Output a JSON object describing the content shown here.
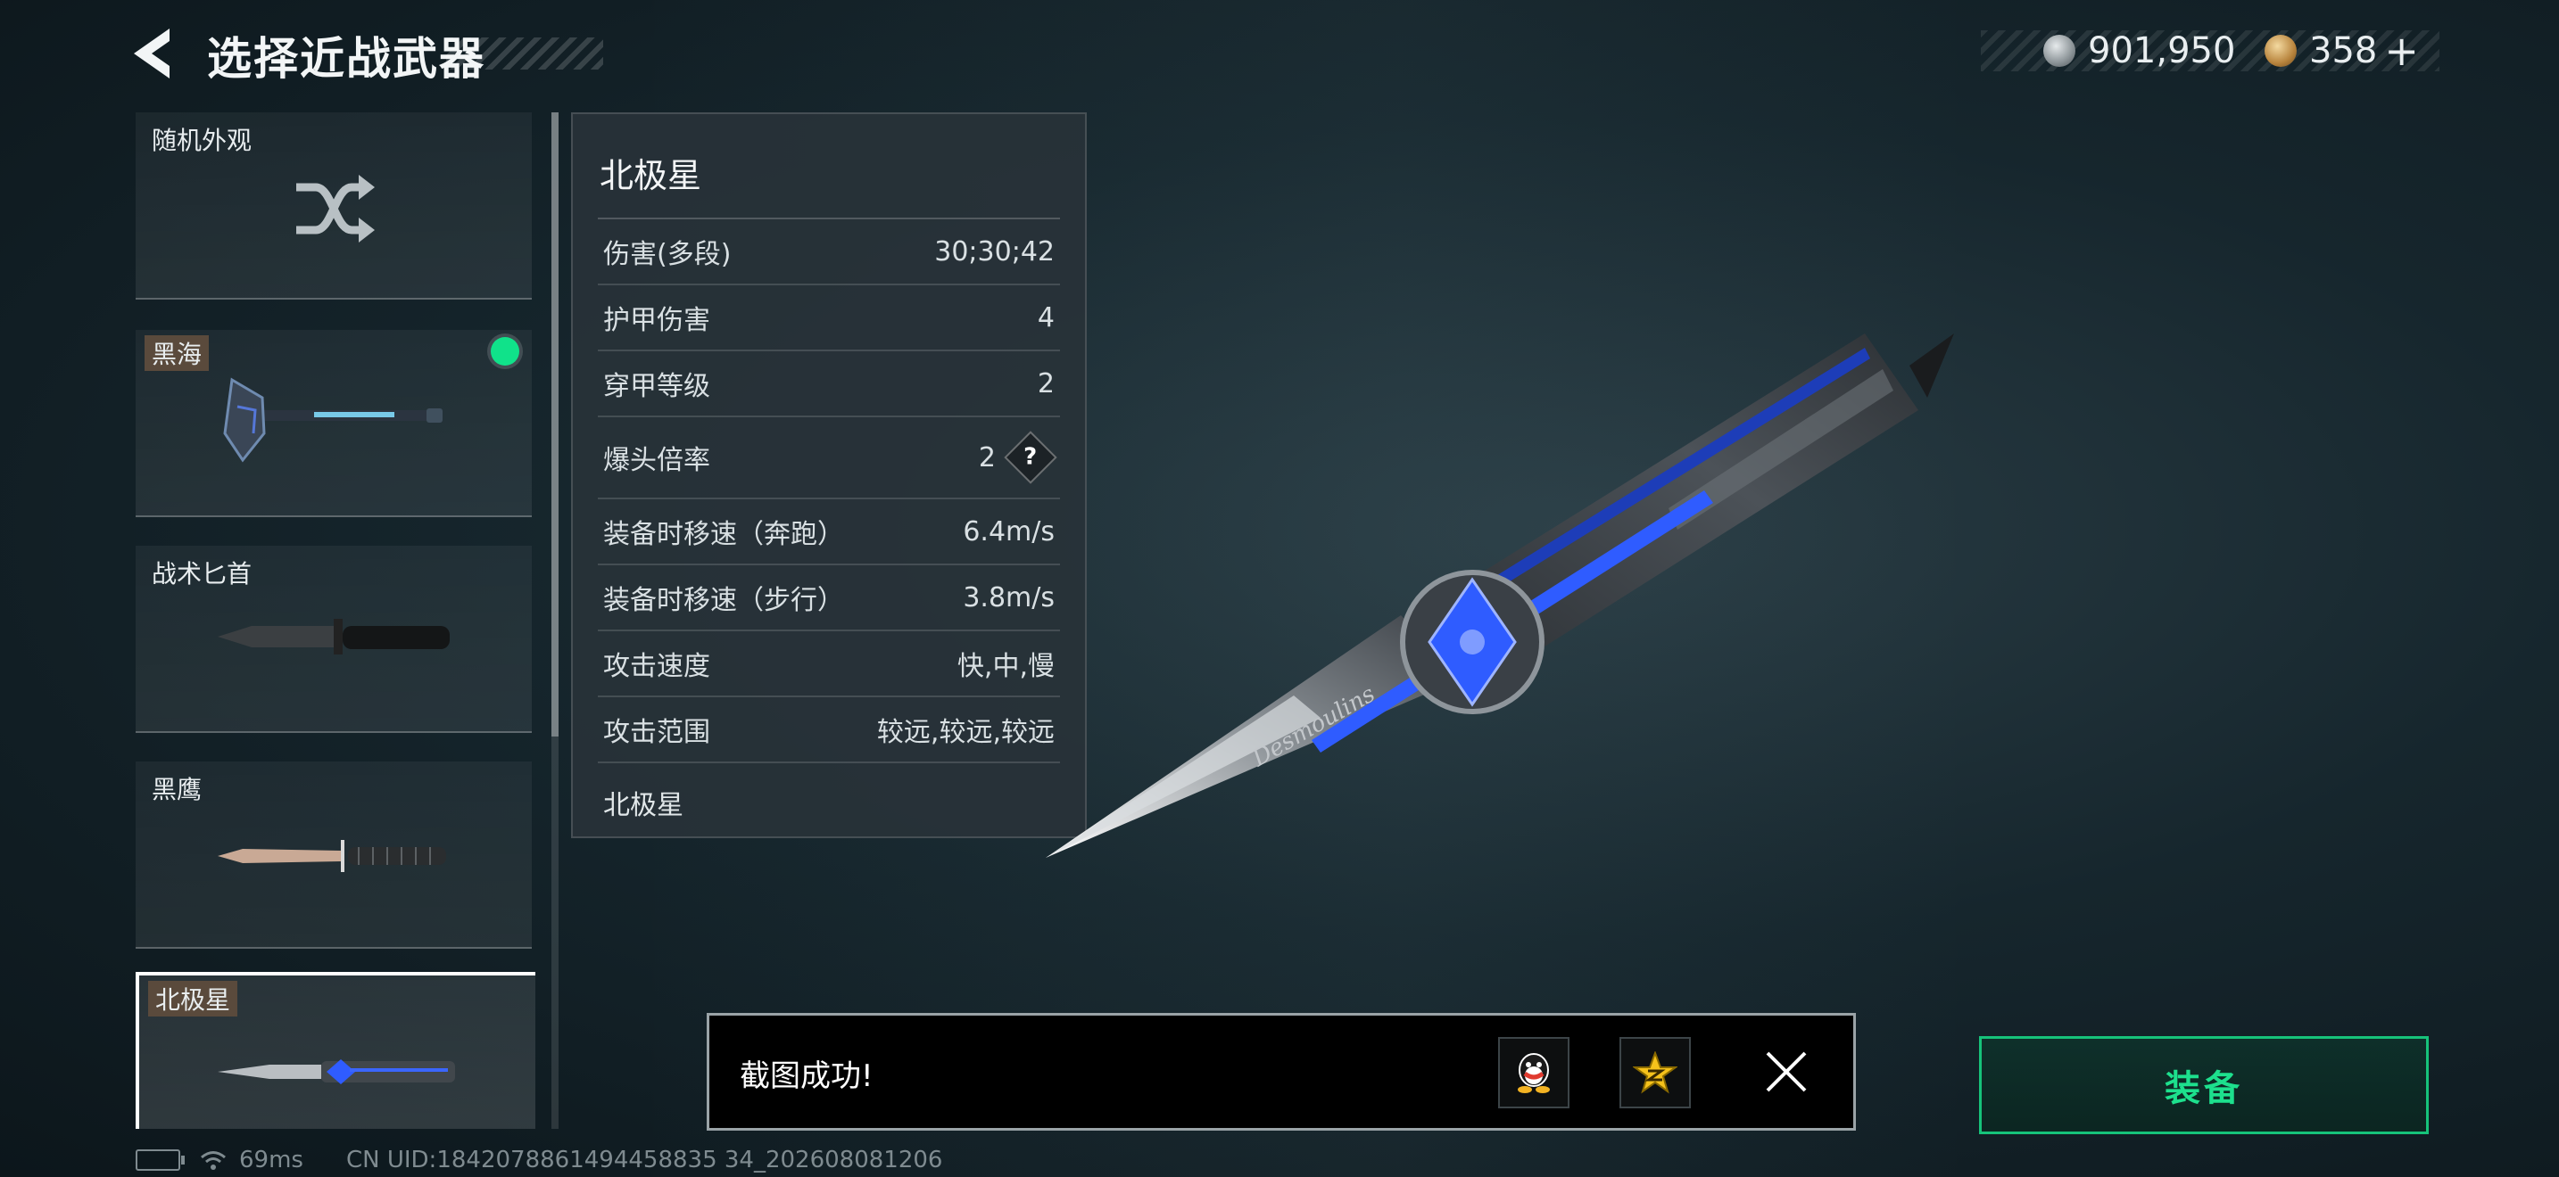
{
  "header": {
    "title": "选择近战武器",
    "currency_1": "901,950",
    "currency_2": "358",
    "add_symbol": "+"
  },
  "weapon_list": [
    {
      "name": "随机外观",
      "icon": "shuffle-icon"
    },
    {
      "name": "黑海",
      "tagged": true,
      "equipped": true
    },
    {
      "name": "战术匕首"
    },
    {
      "name": "黑鹰"
    },
    {
      "name": "北极星",
      "tagged": true,
      "selected": true
    }
  ],
  "stats": {
    "title": "北极星",
    "rows": [
      {
        "label": "伤害(多段)",
        "value": "30;30;42"
      },
      {
        "label": "护甲伤害",
        "value": "4"
      },
      {
        "label": "穿甲等级",
        "value": "2"
      },
      {
        "label": "爆头倍率",
        "value": "2"
      },
      {
        "label": "装备时移速（奔跑）",
        "value": "6.4m/s"
      },
      {
        "label": "装备时移速（步行）",
        "value": "3.8m/s"
      },
      {
        "label": "攻击速度",
        "value": "快,中,慢"
      },
      {
        "label": "攻击范围",
        "value": "较远,较远,较远"
      }
    ],
    "help_symbol": "?",
    "footer": "北极星"
  },
  "weapon_engraving": "Desmoulins",
  "toast": {
    "text": "截图成功!"
  },
  "equip_label": "装备",
  "status_bar": {
    "ping": "69ms",
    "uid": "CN UID:1842078861494458835 34_202608081206"
  },
  "colors": {
    "accent_green": "#1de08d",
    "equipped_dot": "#10e28a",
    "weapon_blue": "#2f5cff"
  }
}
